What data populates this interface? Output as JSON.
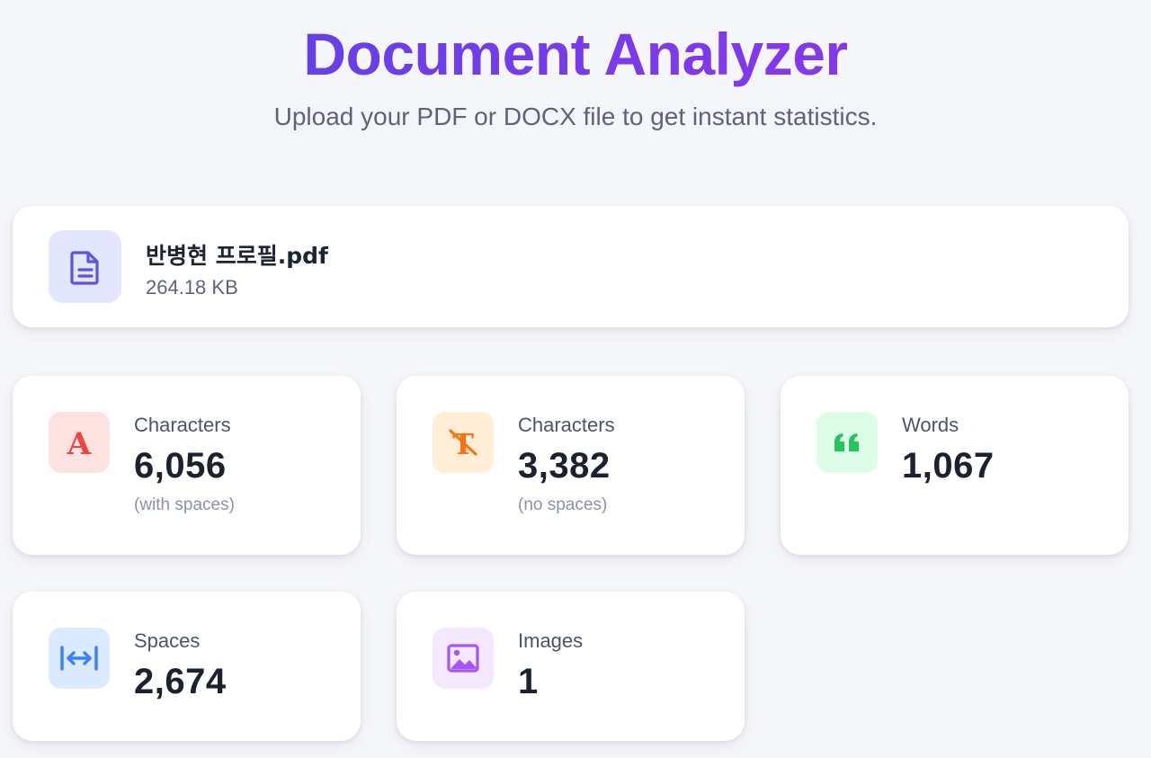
{
  "header": {
    "title": "Document Analyzer",
    "subtitle": "Upload your PDF or DOCX file to get instant statistics."
  },
  "file": {
    "icon": "file-text-icon",
    "name": "반병현 프로필.pdf",
    "size": "264.18 KB"
  },
  "stats": [
    {
      "icon": "letter-a-icon",
      "color": "#ef4444",
      "bg": "#fee2e2",
      "label": "Characters",
      "value": "6,056",
      "note": "(with spaces)"
    },
    {
      "icon": "text-strike-icon",
      "color": "#f97316",
      "bg": "#ffedd5",
      "label": "Characters",
      "value": "3,382",
      "note": "(no spaces)"
    },
    {
      "icon": "quote-icon",
      "color": "#22c55e",
      "bg": "#dcfce7",
      "label": "Words",
      "value": "1,067",
      "note": ""
    },
    {
      "icon": "spacing-arrows-icon",
      "color": "#3b82f6",
      "bg": "#dbeafe",
      "label": "Spaces",
      "value": "2,674",
      "note": ""
    },
    {
      "icon": "image-icon",
      "color": "#a855f7",
      "bg": "#f3e8ff",
      "label": "Images",
      "value": "1",
      "note": ""
    }
  ]
}
